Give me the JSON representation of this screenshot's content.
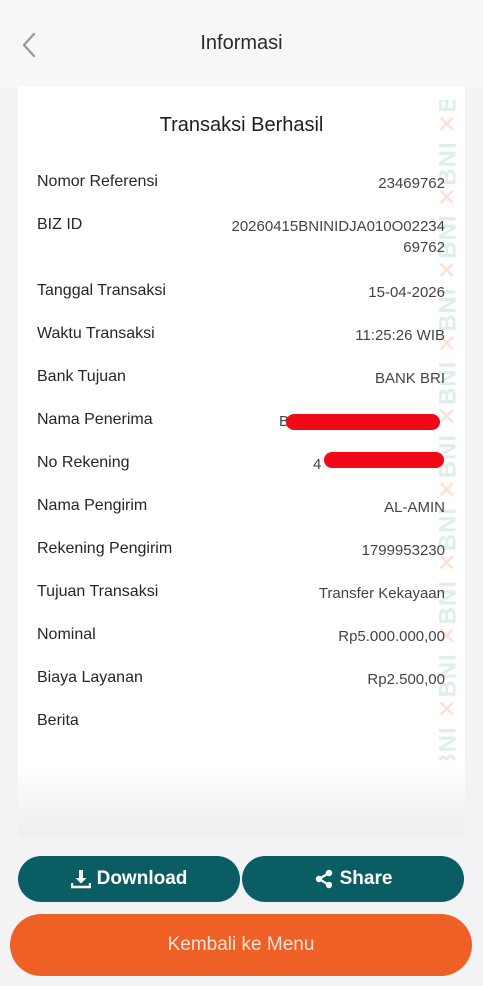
{
  "header": {
    "title": "Informasi"
  },
  "card": {
    "title": "Transaksi Berhasil",
    "rows": [
      {
        "label": "Nomor Referensi",
        "value": "23469762"
      },
      {
        "label": "BIZ ID",
        "value": "20260415BNINIDJA010O0223469762"
      },
      {
        "label": "Tanggal Transaksi",
        "value": "15-04-2026"
      },
      {
        "label": "Waktu Transaksi",
        "value": "11:25:26 WIB"
      },
      {
        "label": "Bank Tujuan",
        "value": "BANK BRI"
      },
      {
        "label": "Nama Penerima",
        "value": "B"
      },
      {
        "label": "No Rekening",
        "value": "4"
      },
      {
        "label": "Nama Pengirim",
        "value": "AL-AMIN"
      },
      {
        "label": "Rekening Pengirim",
        "value": "1799953230"
      },
      {
        "label": "Tujuan Transaksi",
        "value": "Transfer Kekayaan"
      },
      {
        "label": "Nominal",
        "value": "Rp5.000.000,00"
      },
      {
        "label": "Biaya Layanan",
        "value": "Rp2.500,00"
      },
      {
        "label": "Berita",
        "value": ""
      }
    ]
  },
  "watermark": {
    "mark": "✕",
    "brand": "BNI"
  },
  "actions": {
    "download_label": "Download",
    "share_label": "Share",
    "menu_label": "Kembali ke Menu"
  },
  "colors": {
    "primary_teal": "#0b5d64",
    "accent_orange": "#ef6026",
    "redaction_red": "#f00a18"
  },
  "icons": {
    "back": "chevron-left-icon",
    "download": "download-icon",
    "share": "share-icon"
  }
}
